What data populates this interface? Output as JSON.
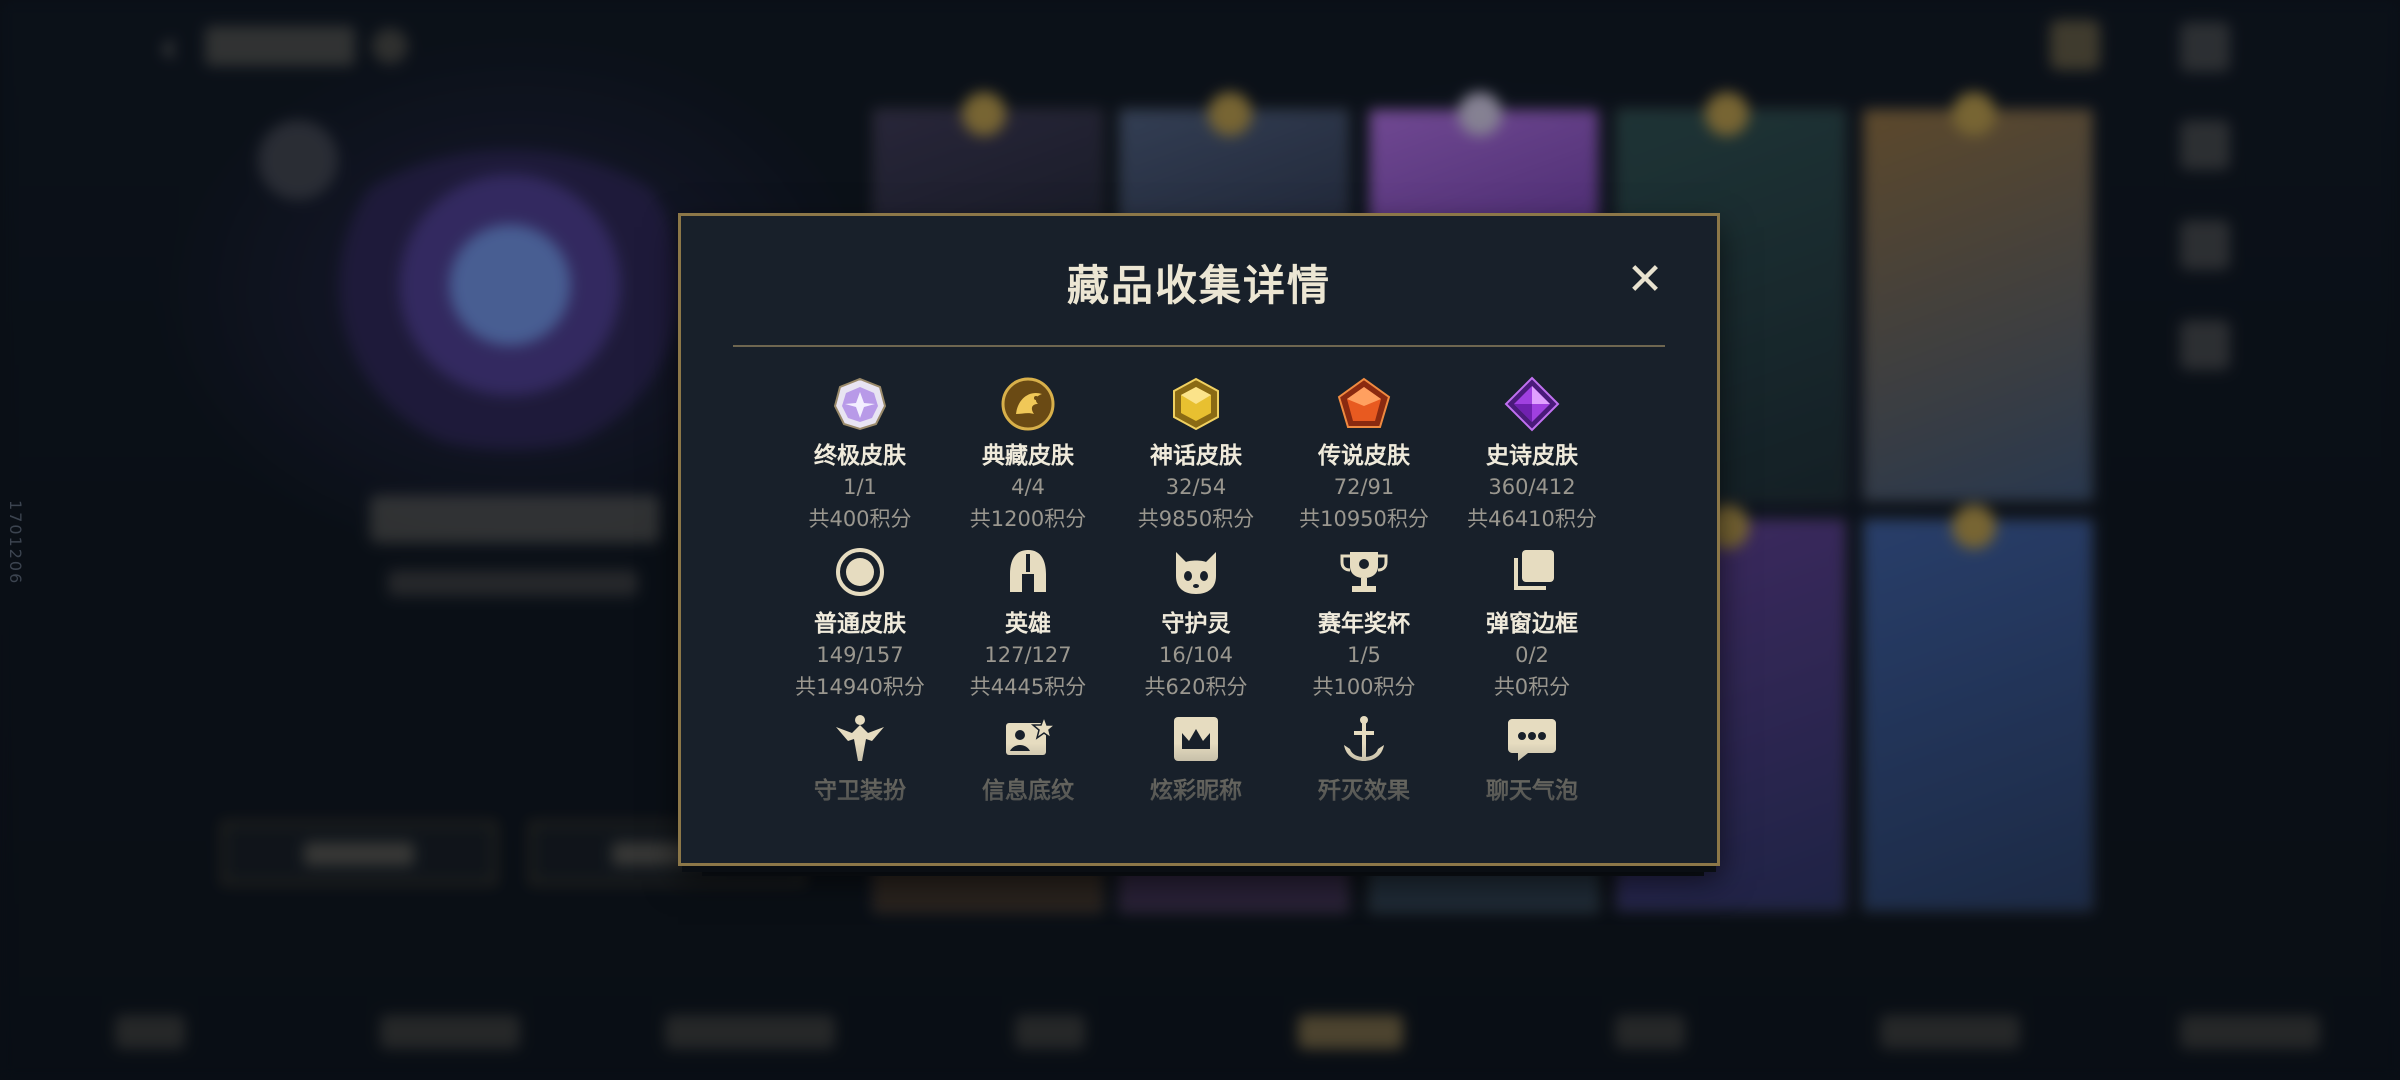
{
  "background": {
    "side_vertical_text": "1701206"
  },
  "modal": {
    "title": "藏品收集详情",
    "close_glyph": "✕",
    "rows": [
      [
        {
          "icon": "ultimate-skin-icon",
          "label": "终极皮肤",
          "count": "1/1",
          "points": "共400积分"
        },
        {
          "icon": "collector-skin-icon",
          "label": "典藏皮肤",
          "count": "4/4",
          "points": "共1200积分"
        },
        {
          "icon": "mythic-skin-icon",
          "label": "神话皮肤",
          "count": "32/54",
          "points": "共9850积分"
        },
        {
          "icon": "legendary-skin-icon",
          "label": "传说皮肤",
          "count": "72/91",
          "points": "共10950积分"
        },
        {
          "icon": "epic-skin-icon",
          "label": "史诗皮肤",
          "count": "360/412",
          "points": "共46410积分"
        }
      ],
      [
        {
          "icon": "normal-skin-icon",
          "label": "普通皮肤",
          "count": "149/157",
          "points": "共14940积分"
        },
        {
          "icon": "champion-helmet-icon",
          "label": "英雄",
          "count": "127/127",
          "points": "共4445积分"
        },
        {
          "icon": "guardian-spirit-icon",
          "label": "守护灵",
          "count": "16/104",
          "points": "共620积分"
        },
        {
          "icon": "season-trophy-icon",
          "label": "赛年奖杯",
          "count": "1/5",
          "points": "共100积分"
        },
        {
          "icon": "popup-frame-icon",
          "label": "弹窗边框",
          "count": "0/2",
          "points": "共0积分"
        }
      ],
      [
        {
          "icon": "guard-outfit-icon",
          "label": "守卫装扮"
        },
        {
          "icon": "info-pattern-icon",
          "label": "信息底纹"
        },
        {
          "icon": "colorful-nickname-icon",
          "label": "炫彩昵称"
        },
        {
          "icon": "annihilation-effect-icon",
          "label": "歼灭效果"
        },
        {
          "icon": "chat-bubble-icon",
          "label": "聊天气泡"
        }
      ]
    ]
  }
}
